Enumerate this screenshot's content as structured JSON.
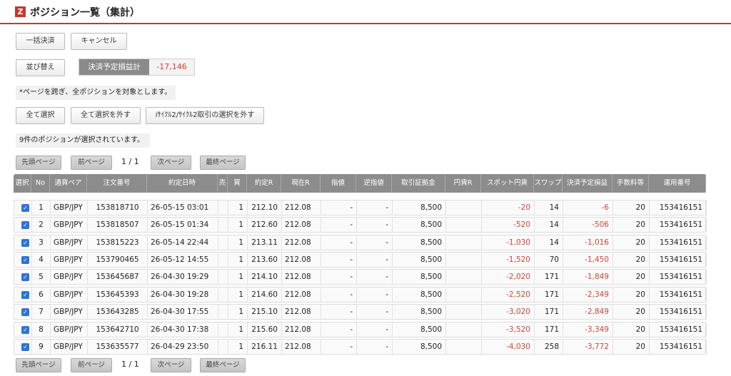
{
  "header": {
    "logo": "Z",
    "title": "ポジション一覧（集計）"
  },
  "toolbar": {
    "bulk_settle": "一括決済",
    "cancel": "キャンセル",
    "sort": "並び替え"
  },
  "settlement_pl": {
    "label": "決済予定損益計",
    "value": "-17,146"
  },
  "notice": "*ページを跨ぎ、全ポジションを対象とします。",
  "selection": {
    "select_all": "全て選択",
    "deselect_all": "全て選択を外す",
    "deselect_cycle": "iｻｲｸﾙ2/ｻｲｸﾙ2取引の選択を外す"
  },
  "selected_status": "9件のポジションが選択されています。",
  "pagination": {
    "first": "先頭ページ",
    "prev": "前ページ",
    "page_info": "1 / 1",
    "next": "次ページ",
    "last": "最終ページ"
  },
  "table": {
    "columns": [
      "選択",
      "No",
      "通貨ペア",
      "注文番号",
      "約定日時",
      "売",
      "買",
      "約定R",
      "現在R",
      "指値",
      "逆指値",
      "取引証拠金",
      "円貨R",
      "スポット円貨",
      "スワップ",
      "決済予定損益",
      "手数料等",
      "運用番号"
    ],
    "rows": [
      {
        "checked": true,
        "no": "1",
        "pair": "GBP/JPY",
        "order": "153818710",
        "datetime": "26-05-15 03:01",
        "sell": "",
        "buy": "1",
        "rate": "212.10",
        "current": "212.08",
        "limit": "-",
        "stop": "-",
        "margin": "8,500",
        "yen_rate": "",
        "spot": "-20",
        "swap": "14",
        "pl": "-6",
        "fee": "20",
        "op": "153416151"
      },
      {
        "checked": true,
        "no": "2",
        "pair": "GBP/JPY",
        "order": "153818507",
        "datetime": "26-05-15 01:34",
        "sell": "",
        "buy": "1",
        "rate": "212.60",
        "current": "212.08",
        "limit": "-",
        "stop": "-",
        "margin": "8,500",
        "yen_rate": "",
        "spot": "-520",
        "swap": "14",
        "pl": "-506",
        "fee": "20",
        "op": "153416151"
      },
      {
        "checked": true,
        "no": "3",
        "pair": "GBP/JPY",
        "order": "153815223",
        "datetime": "26-05-14 22:44",
        "sell": "",
        "buy": "1",
        "rate": "213.11",
        "current": "212.08",
        "limit": "-",
        "stop": "-",
        "margin": "8,500",
        "yen_rate": "",
        "spot": "-1,030",
        "swap": "14",
        "pl": "-1,016",
        "fee": "20",
        "op": "153416151"
      },
      {
        "checked": true,
        "no": "4",
        "pair": "GBP/JPY",
        "order": "153790465",
        "datetime": "26-05-12 14:55",
        "sell": "",
        "buy": "1",
        "rate": "213.60",
        "current": "212.08",
        "limit": "-",
        "stop": "-",
        "margin": "8,500",
        "yen_rate": "",
        "spot": "-1,520",
        "swap": "70",
        "pl": "-1,450",
        "fee": "20",
        "op": "153416151"
      },
      {
        "checked": true,
        "no": "5",
        "pair": "GBP/JPY",
        "order": "153645687",
        "datetime": "26-04-30 19:29",
        "sell": "",
        "buy": "1",
        "rate": "214.10",
        "current": "212.08",
        "limit": "-",
        "stop": "-",
        "margin": "8,500",
        "yen_rate": "",
        "spot": "-2,020",
        "swap": "171",
        "pl": "-1,849",
        "fee": "20",
        "op": "153416151"
      },
      {
        "checked": true,
        "no": "6",
        "pair": "GBP/JPY",
        "order": "153645393",
        "datetime": "26-04-30 19:28",
        "sell": "",
        "buy": "1",
        "rate": "214.60",
        "current": "212.08",
        "limit": "-",
        "stop": "-",
        "margin": "8,500",
        "yen_rate": "",
        "spot": "-2,520",
        "swap": "171",
        "pl": "-2,349",
        "fee": "20",
        "op": "153416151"
      },
      {
        "checked": true,
        "no": "7",
        "pair": "GBP/JPY",
        "order": "153643285",
        "datetime": "26-04-30 17:55",
        "sell": "",
        "buy": "1",
        "rate": "215.10",
        "current": "212.08",
        "limit": "-",
        "stop": "-",
        "margin": "8,500",
        "yen_rate": "",
        "spot": "-3,020",
        "swap": "171",
        "pl": "-2,849",
        "fee": "20",
        "op": "153416151"
      },
      {
        "checked": true,
        "no": "8",
        "pair": "GBP/JPY",
        "order": "153642710",
        "datetime": "26-04-30 17:38",
        "sell": "",
        "buy": "1",
        "rate": "215.60",
        "current": "212.08",
        "limit": "-",
        "stop": "-",
        "margin": "8,500",
        "yen_rate": "",
        "spot": "-3,520",
        "swap": "171",
        "pl": "-3,349",
        "fee": "20",
        "op": "153416151"
      },
      {
        "checked": true,
        "no": "9",
        "pair": "GBP/JPY",
        "order": "153635577",
        "datetime": "26-04-29 23:50",
        "sell": "",
        "buy": "1",
        "rate": "216.11",
        "current": "212.08",
        "limit": "-",
        "stop": "-",
        "margin": "8,500",
        "yen_rate": "",
        "spot": "-4,030",
        "swap": "258",
        "pl": "-3,772",
        "fee": "20",
        "op": "153416151"
      }
    ]
  },
  "colors": {
    "accent": "#c0392b",
    "negative": "#d0453a",
    "checkbox": "#2e73d8",
    "header_bg": "#8c8c8c"
  }
}
